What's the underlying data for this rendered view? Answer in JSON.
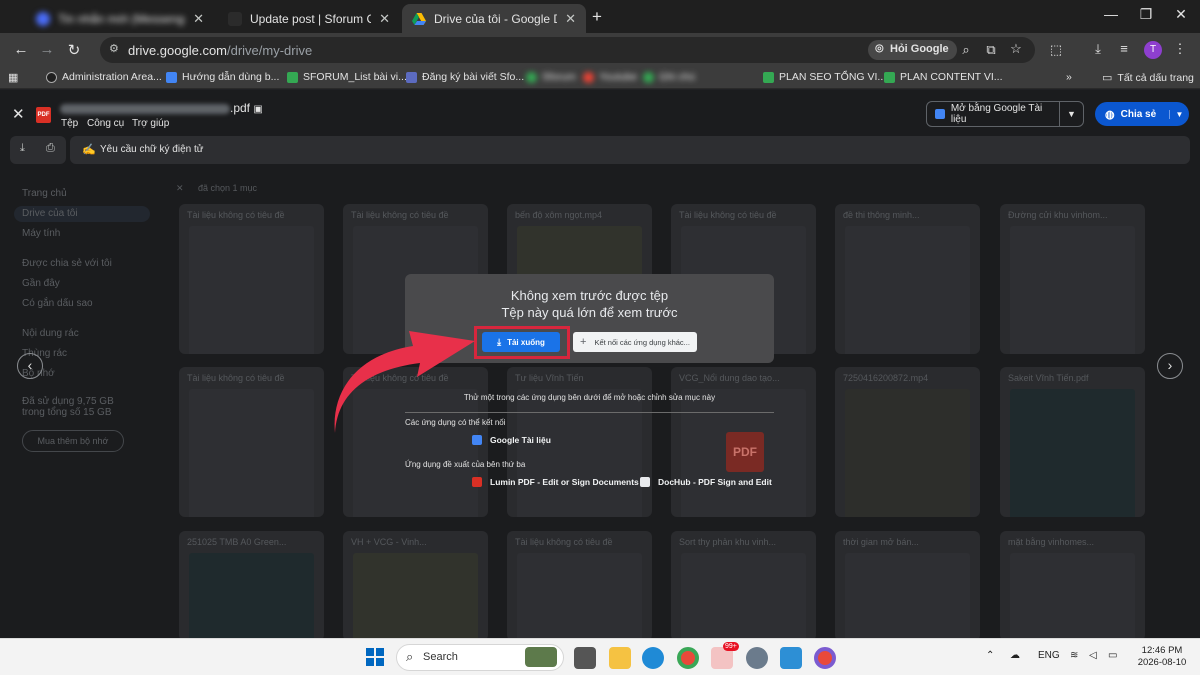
{
  "browser": {
    "tabs": [
      {
        "title": "Tin nhắn mới (Messenger)",
        "blurred": true
      },
      {
        "title": "Update post | Sforum CMS",
        "blurred": false
      },
      {
        "title": "Drive của tôi - Google Drive",
        "blurred": false
      }
    ],
    "new_tab": "+",
    "url_host": "drive.google.com",
    "url_path": "/drive/my-drive",
    "ask_google": "Hỏi Google",
    "profile_initial": "T"
  },
  "bookmarks": {
    "items": [
      "Administration Area...",
      "Hướng dẫn dùng b...",
      "SFORUM_List bài vi...",
      "Đăng ký bài viết Sfo...",
      "Sforum",
      "Youtube",
      "Ghi chú",
      "PLAN SEO TỔNG VI...",
      "PLAN CONTENT VI..."
    ],
    "more": "»",
    "all_bookmarks": "Tất cả dấu trang"
  },
  "viewer": {
    "file_ext": ".pdf",
    "pdf_badge": "PDF",
    "menu": [
      "Tệp",
      "Công cụ",
      "Trợ giúp"
    ],
    "open_with": "Mở bằng Google Tài liệu",
    "share": "Chia sẻ",
    "signature_request": "Yêu cầu chữ ký điện tử"
  },
  "drive_background": {
    "sidebar": [
      "Trang chủ",
      "Drive của tôi",
      "Máy tính",
      "Được chia sẻ với tôi",
      "Gần đây",
      "Có gắn dấu sao",
      "Nội dung rác",
      "Thùng rác",
      "Bộ nhớ"
    ],
    "storage_text": "Đã sử dụng 9,75 GB trong tổng số 15 GB",
    "buy_storage": "Mua thêm bộ nhớ",
    "selection": "đã chọn 1 mục",
    "thumbnails": [
      "Tài liệu không có tiêu đề",
      "Tài liệu không có tiêu đề",
      "bến độ xôm ngọt.mp4",
      "Tài liệu không có tiêu đề",
      "đề thi thông minh...",
      "Đường cửi khu vinhom...",
      "Tài liệu không có tiêu đề",
      "Tài liệu không có tiêu đề",
      "Tư liệu Vĩnh Tiến",
      "VCG_Nổi dung dao tạo...",
      "7250416200872.mp4",
      "Sakeit Vĩnh Tiến.pdf",
      "251025 TMB A0 Green...",
      "VH + VCG - Vinh...",
      "Tài liệu không có tiêu đề",
      "Sort thy phản khu vinh...",
      "thời gian mở bán...",
      "mặt bằng vinhomes..."
    ]
  },
  "dialog": {
    "title": "Không xem trước được tệp",
    "subtitle": "Tệp này quá lớn để xem trước",
    "download": "Tải xuống",
    "connect": "Kết nối các ứng dụng khác..."
  },
  "suggestions": {
    "intro": "Thử một trong các ứng dụng bên dưới để mở hoặc chỉnh sửa mục này",
    "connectable_heading": "Các ứng dụng có thể kết nối",
    "google_docs": "Google Tài liệu",
    "third_party_heading": "Ứng dụng đề xuất của bên thứ ba",
    "lumin": "Lumin PDF - Edit or Sign Documents",
    "dochub": "DocHub - PDF Sign and Edit",
    "pdf_tile": "PDF"
  },
  "taskbar": {
    "search": "Search",
    "language": "ENG",
    "time": "12:46 PM",
    "date": "2026-08-10",
    "notification_badge": "99+"
  },
  "colors": {
    "accent_blue": "#1a73e8",
    "share_blue": "#0b57d0",
    "highlight_red": "#d7263d",
    "arrow_red": "#e8304a"
  }
}
